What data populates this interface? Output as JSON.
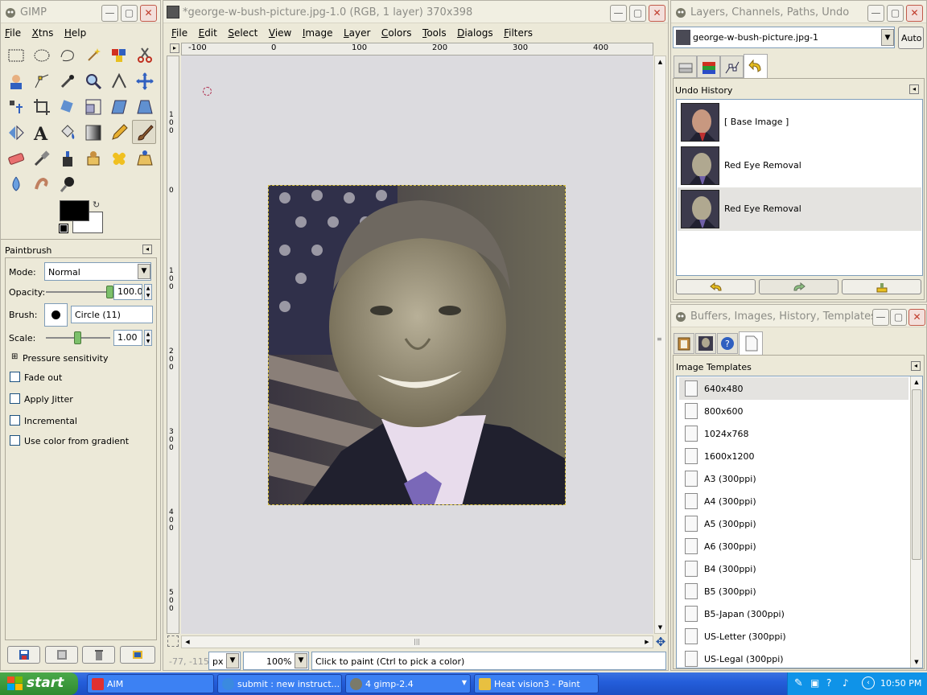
{
  "toolbox": {
    "title": "GIMP",
    "menu": [
      "File",
      "Xtns",
      "Help"
    ],
    "tools": [
      "rect-select",
      "ellipse-select",
      "free-select",
      "fuzzy-select",
      "select-by-color",
      "scissors",
      "foreground-select",
      "paths",
      "color-picker",
      "zoom",
      "measure",
      "move",
      "align",
      "crop",
      "rotate",
      "scale",
      "shear",
      "perspective",
      "flip",
      "text",
      "bucket-fill",
      "blend",
      "pencil",
      "paintbrush",
      "eraser",
      "airbrush",
      "ink",
      "clone",
      "heal",
      "perspective-clone",
      "blur",
      "smudge",
      "dodge-burn"
    ],
    "fg_color": "#000000",
    "bg_color": "#ffffff"
  },
  "tool_options": {
    "title": "Paintbrush",
    "mode_label": "Mode:",
    "mode_value": "Normal",
    "opacity_label": "Opacity:",
    "opacity_value": "100.0",
    "opacity_level": 1.0,
    "brush_label": "Brush:",
    "brush_value": "Circle (11)",
    "scale_label": "Scale:",
    "scale_value": "1.00",
    "scale_level": 0.5,
    "pressure": "Pressure sensitivity",
    "checkboxes": [
      "Fade out",
      "Apply Jitter",
      "Incremental",
      "Use color from gradient"
    ]
  },
  "image_window": {
    "title": "*george-w-bush-picture.jpg-1.0 (RGB, 1 layer) 370x398",
    "menu": [
      "File",
      "Edit",
      "Select",
      "View",
      "Image",
      "Layer",
      "Colors",
      "Tools",
      "Dialogs",
      "Filters"
    ],
    "hruler_labels": [
      "-100",
      "0",
      "100",
      "200",
      "300",
      "400"
    ],
    "vruler_labels": [
      "100",
      "0",
      "100",
      "200",
      "300",
      "400",
      "500"
    ],
    "coords": "-77, -115",
    "unit": "px",
    "zoom": "100%",
    "status": "Click to paint (Ctrl to pick a color)"
  },
  "layers_dock": {
    "title": "Layers, Channels, Paths, Undo",
    "image_name": "george-w-bush-picture.jpg-1",
    "auto_label": "Auto",
    "section": "Undo History",
    "history": [
      "[ Base Image ]",
      "Red Eye Removal",
      "Red Eye Removal"
    ]
  },
  "buffers_dock": {
    "title": "Buffers, Images, History, Templates",
    "section": "Image Templates",
    "templates": [
      "640x480",
      "800x600",
      "1024x768",
      "1600x1200",
      "A3 (300ppi)",
      "A4 (300ppi)",
      "A5 (300ppi)",
      "A6 (300ppi)",
      "B4 (300ppi)",
      "B5 (300ppi)",
      "B5-Japan (300ppi)",
      "US-Letter (300ppi)",
      "US-Legal (300ppi)"
    ]
  },
  "taskbar": {
    "start": "start",
    "tasks": [
      "AIM",
      "submit : new instruct...",
      "4 gimp-2.4",
      "Heat vision3 - Paint"
    ],
    "clock": "10:50 PM"
  }
}
